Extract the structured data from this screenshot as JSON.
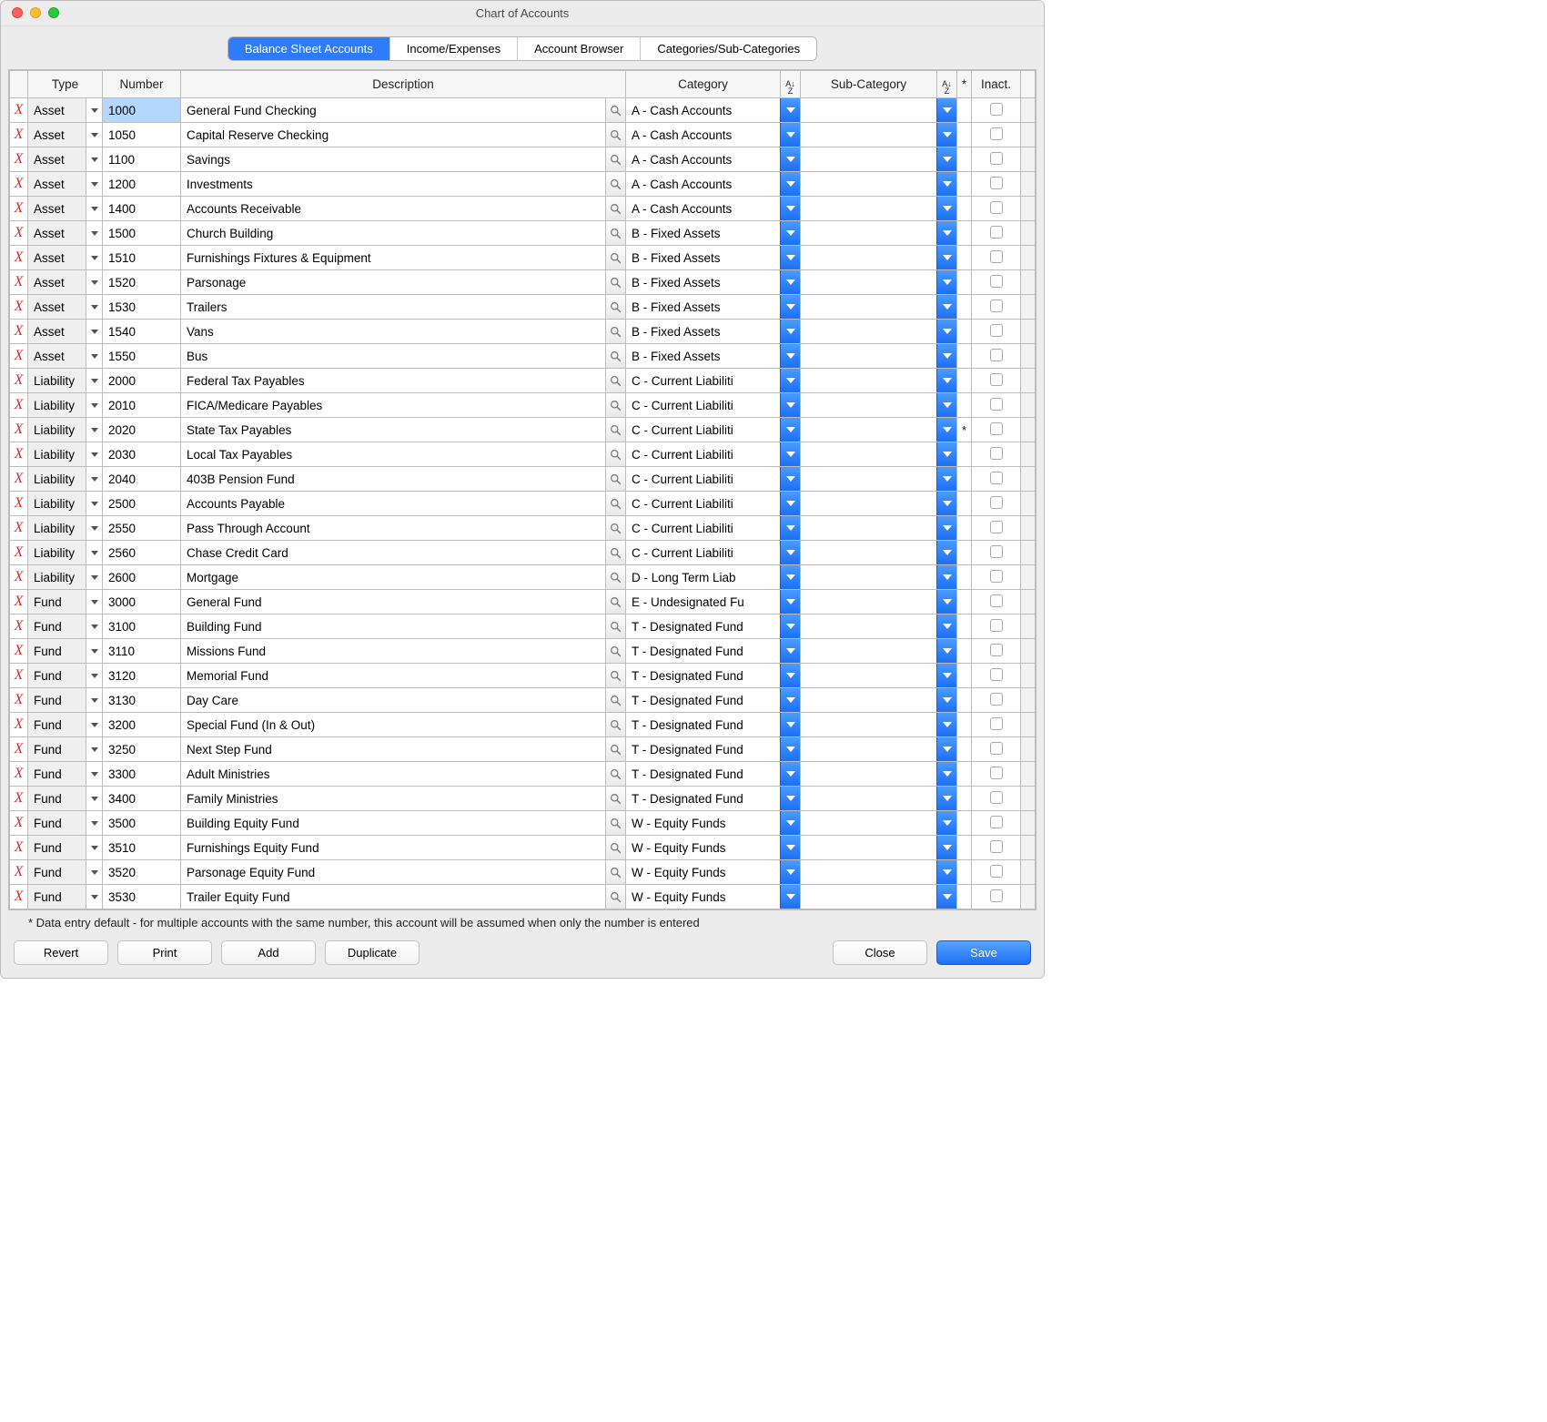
{
  "window": {
    "title": "Chart of Accounts"
  },
  "tabs": {
    "balance": "Balance Sheet Accounts",
    "income": "Income/Expenses",
    "browser": "Account Browser",
    "categories": "Categories/Sub-Categories"
  },
  "columns": {
    "type": "Type",
    "number": "Number",
    "description": "Description",
    "category": "Category",
    "subcategory": "Sub-Category",
    "star": "*",
    "inact": "Inact."
  },
  "sort_glyph": "A↓\nZ",
  "rows": [
    {
      "type": "Asset",
      "num": "1000",
      "num_sel": true,
      "desc": "General Fund Checking",
      "cat": "A - Cash Accounts",
      "sub": "",
      "star": "",
      "inact": false
    },
    {
      "type": "Asset",
      "num": "1050",
      "desc": "Capital Reserve Checking",
      "cat": "A - Cash Accounts",
      "sub": "",
      "star": "",
      "inact": false
    },
    {
      "type": "Asset",
      "num": "1100",
      "desc": "Savings",
      "cat": "A - Cash Accounts",
      "sub": "",
      "star": "",
      "inact": false
    },
    {
      "type": "Asset",
      "num": "1200",
      "desc": "Investments",
      "cat": "A - Cash Accounts",
      "sub": "",
      "star": "",
      "inact": false
    },
    {
      "type": "Asset",
      "num": "1400",
      "desc": "Accounts Receivable",
      "cat": "A - Cash Accounts",
      "sub": "",
      "star": "",
      "inact": false
    },
    {
      "type": "Asset",
      "num": "1500",
      "desc": "Church Building",
      "cat": "B - Fixed Assets",
      "sub": "",
      "star": "",
      "inact": false
    },
    {
      "type": "Asset",
      "num": "1510",
      "desc": "Furnishings Fixtures & Equipment",
      "cat": "B - Fixed Assets",
      "sub": "",
      "star": "",
      "inact": false
    },
    {
      "type": "Asset",
      "num": "1520",
      "desc": "Parsonage",
      "cat": "B - Fixed Assets",
      "sub": "",
      "star": "",
      "inact": false
    },
    {
      "type": "Asset",
      "num": "1530",
      "desc": "Trailers",
      "cat": "B - Fixed Assets",
      "sub": "",
      "star": "",
      "inact": false
    },
    {
      "type": "Asset",
      "num": "1540",
      "desc": "Vans",
      "cat": "B - Fixed Assets",
      "sub": "",
      "star": "",
      "inact": false
    },
    {
      "type": "Asset",
      "num": "1550",
      "desc": "Bus",
      "cat": "B - Fixed Assets",
      "sub": "",
      "star": "",
      "inact": false
    },
    {
      "type": "Liability",
      "num": "2000",
      "desc": "Federal Tax Payables",
      "cat": "C - Current Liabiliti",
      "sub": "",
      "star": "",
      "inact": false
    },
    {
      "type": "Liability",
      "num": "2010",
      "desc": "FICA/Medicare Payables",
      "cat": "C - Current Liabiliti",
      "sub": "",
      "star": "",
      "inact": false
    },
    {
      "type": "Liability",
      "num": "2020",
      "desc": "State Tax Payables",
      "cat": "C - Current Liabiliti",
      "sub": "",
      "star": "*",
      "inact": false
    },
    {
      "type": "Liability",
      "num": "2030",
      "desc": "Local Tax Payables",
      "cat": "C - Current Liabiliti",
      "sub": "",
      "star": "",
      "inact": false
    },
    {
      "type": "Liability",
      "num": "2040",
      "desc": "403B Pension Fund",
      "cat": "C - Current Liabiliti",
      "sub": "",
      "star": "",
      "inact": false
    },
    {
      "type": "Liability",
      "num": "2500",
      "desc": "Accounts Payable",
      "cat": "C - Current Liabiliti",
      "sub": "",
      "star": "",
      "inact": false
    },
    {
      "type": "Liability",
      "num": "2550",
      "desc": "Pass Through Account",
      "cat": "C - Current Liabiliti",
      "sub": "",
      "star": "",
      "inact": false
    },
    {
      "type": "Liability",
      "num": "2560",
      "desc": "Chase Credit Card",
      "cat": "C - Current Liabiliti",
      "sub": "",
      "star": "",
      "inact": false
    },
    {
      "type": "Liability",
      "num": "2600",
      "desc": "Mortgage",
      "cat": "D - Long Term Liab",
      "sub": "",
      "star": "",
      "inact": false
    },
    {
      "type": "Fund",
      "num": "3000",
      "desc": "General Fund",
      "cat": "E - Undesignated Fu",
      "sub": "",
      "star": "",
      "inact": false
    },
    {
      "type": "Fund",
      "num": "3100",
      "desc": "Building Fund",
      "cat": "T - Designated Fund",
      "sub": "",
      "star": "",
      "inact": false
    },
    {
      "type": "Fund",
      "num": "3110",
      "desc": "Missions Fund",
      "cat": "T - Designated Fund",
      "sub": "",
      "star": "",
      "inact": false
    },
    {
      "type": "Fund",
      "num": "3120",
      "desc": "Memorial Fund",
      "cat": "T - Designated Fund",
      "sub": "",
      "star": "",
      "inact": false
    },
    {
      "type": "Fund",
      "num": "3130",
      "desc": "Day Care",
      "cat": "T - Designated Fund",
      "sub": "",
      "star": "",
      "inact": false
    },
    {
      "type": "Fund",
      "num": "3200",
      "desc": "Special Fund (In & Out)",
      "cat": "T - Designated Fund",
      "sub": "",
      "star": "",
      "inact": false
    },
    {
      "type": "Fund",
      "num": "3250",
      "desc": "Next Step Fund",
      "cat": "T - Designated Fund",
      "sub": "",
      "star": "",
      "inact": false
    },
    {
      "type": "Fund",
      "num": "3300",
      "desc": "Adult Ministries",
      "cat": "T - Designated Fund",
      "sub": "",
      "star": "",
      "inact": false
    },
    {
      "type": "Fund",
      "num": "3400",
      "desc": "Family Ministries",
      "cat": "T - Designated Fund",
      "sub": "",
      "star": "",
      "inact": false
    },
    {
      "type": "Fund",
      "num": "3500",
      "desc": "Building Equity Fund",
      "cat": "W - Equity Funds",
      "sub": "",
      "star": "",
      "inact": false
    },
    {
      "type": "Fund",
      "num": "3510",
      "desc": "Furnishings Equity Fund",
      "cat": "W - Equity Funds",
      "sub": "",
      "star": "",
      "inact": false
    },
    {
      "type": "Fund",
      "num": "3520",
      "desc": "Parsonage Equity Fund",
      "cat": "W - Equity Funds",
      "sub": "",
      "star": "",
      "inact": false
    },
    {
      "type": "Fund",
      "num": "3530",
      "desc": "Trailer Equity Fund",
      "cat": "W - Equity Funds",
      "sub": "",
      "star": "",
      "inact": false
    }
  ],
  "footer_note": "* Data entry default - for multiple accounts with the same number, this account will be assumed when only the number is entered",
  "buttons": {
    "revert": "Revert",
    "print": "Print",
    "add": "Add",
    "duplicate": "Duplicate",
    "close": "Close",
    "save": "Save"
  }
}
